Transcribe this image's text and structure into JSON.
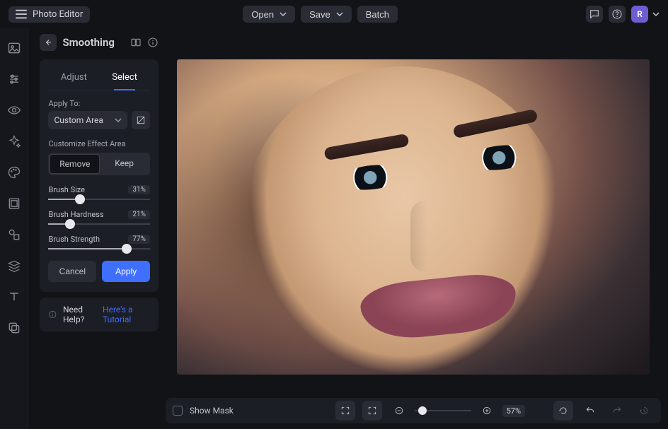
{
  "app": {
    "name": "Photo Editor"
  },
  "top": {
    "open": "Open",
    "save": "Save",
    "batch": "Batch",
    "avatar_letter": "R"
  },
  "panel": {
    "title": "Smoothing",
    "tabs": {
      "adjust": "Adjust",
      "select": "Select"
    },
    "apply_to_label": "Apply To:",
    "apply_to_value": "Custom Area",
    "effect_area_label": "Customize Effect Area",
    "seg_remove": "Remove",
    "seg_keep": "Keep",
    "brush_size_label": "Brush Size",
    "brush_size_value": "31%",
    "brush_size_pct": 31,
    "brush_hardness_label": "Brush Hardness",
    "brush_hardness_value": "21%",
    "brush_hardness_pct": 21,
    "brush_strength_label": "Brush Strength",
    "brush_strength_value": "77%",
    "brush_strength_pct": 77,
    "cancel": "Cancel",
    "apply": "Apply"
  },
  "help": {
    "text": "Need Help? ",
    "link": "Here's a Tutorial"
  },
  "bottom": {
    "show_mask": "Show Mask",
    "zoom_value": "57%",
    "zoom_pct": 57
  }
}
